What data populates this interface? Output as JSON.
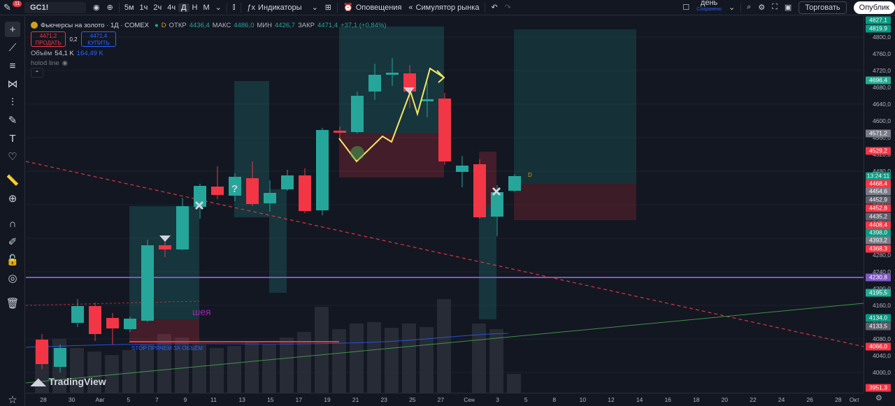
{
  "topbar": {
    "badge": "11",
    "symbol": "GC1!",
    "intervals": [
      "5м",
      "1ч",
      "2ч",
      "4ч",
      "Д",
      "Н",
      "М"
    ],
    "active_interval": "Д",
    "indicators": "Индикаторы",
    "alerts": "Оповещения",
    "replay": "Симулятор рынка",
    "layout_name": "день",
    "layout_status": "Сохранено",
    "trade": "Торговать",
    "publish": "Опублик"
  },
  "legend": {
    "title": "Фьючерсы на золото · 1Д · COMEX",
    "ohlc": [
      {
        "label": "ОТКР",
        "value": "4436,4"
      },
      {
        "label": "МАКС",
        "value": "4486,0"
      },
      {
        "label": "МИН",
        "value": "4426,7"
      },
      {
        "label": "ЗАКР",
        "value": "4471,4"
      }
    ],
    "change": "+37,1 (+0,84%)",
    "sell_price": "4471,2",
    "sell_label": "ПРОДАТЬ",
    "spread": "0,2",
    "buy_price": "4471,4",
    "buy_label": "КУПИТЬ",
    "volume_label": "Объём",
    "volume_value": "54,1 K",
    "volume_ma": "164,49 K",
    "indicator_name": "holod line"
  },
  "chart_annotations": {
    "neck": "шея",
    "stop_label": "STOP ПРЯЧЕМ ЗА ОБЪЁМ",
    "question": "?",
    "dividend_marker": "D"
  },
  "price_axis": {
    "ticks": [
      "4800,0",
      "4760,0",
      "4720,0",
      "4680,0",
      "4640,0",
      "4600,0",
      "4560,0",
      "4520,0",
      "4480,0",
      "4440,0",
      "4400,0",
      "4360,0",
      "4320,0",
      "4280,0",
      "4240,0",
      "4200,0",
      "4160,0",
      "4120,0",
      "4080,0",
      "4040,0",
      "4000,0",
      "3960,0"
    ],
    "tags": [
      {
        "text": "4827,1",
        "color": "#089981"
      },
      {
        "text": "4819,9",
        "color": "#089981"
      },
      {
        "text": "4696,4",
        "color": "#22ab94"
      },
      {
        "text": "4571,2",
        "color": "#787b86"
      },
      {
        "text": "4529,2",
        "color": "#f23645"
      },
      {
        "text": "13:24:11",
        "color": "#089981"
      },
      {
        "text": "4468,4",
        "color": "#f23645"
      },
      {
        "text": "4454,6",
        "color": "#787b86"
      },
      {
        "text": "4452,9",
        "color": "#5d606b"
      },
      {
        "text": "4452,8",
        "color": "#f23645"
      },
      {
        "text": "4435,2",
        "color": "#5d606b"
      },
      {
        "text": "4408,4",
        "color": "#f23645"
      },
      {
        "text": "4398,0",
        "color": "#089981"
      },
      {
        "text": "4393,2",
        "color": "#787b86"
      },
      {
        "text": "4368,3",
        "color": "#f23645"
      },
      {
        "text": "4230,8",
        "color": "#7e57c2"
      },
      {
        "text": "4195,5",
        "color": "#22ab94"
      },
      {
        "text": "4134,0",
        "color": "#089981"
      },
      {
        "text": "4133,5",
        "color": "#5d606b"
      },
      {
        "text": "4066,0",
        "color": "#f23645"
      },
      {
        "text": "3951,3",
        "color": "#f23645"
      }
    ]
  },
  "time_axis": [
    "28",
    "30",
    "Авг",
    "5",
    "7",
    "9",
    "11",
    "13",
    "15",
    "17",
    "19",
    "21",
    "23",
    "25",
    "27",
    "Сен",
    "3",
    "5",
    "8",
    "10",
    "12",
    "14",
    "16",
    "18",
    "20",
    "22",
    "24",
    "26",
    "28",
    "Окт"
  ],
  "branding": "TradingView",
  "colors": {
    "up": "#26a69a",
    "down": "#f23645",
    "level": "#7e57c2",
    "background": "#131722"
  }
}
